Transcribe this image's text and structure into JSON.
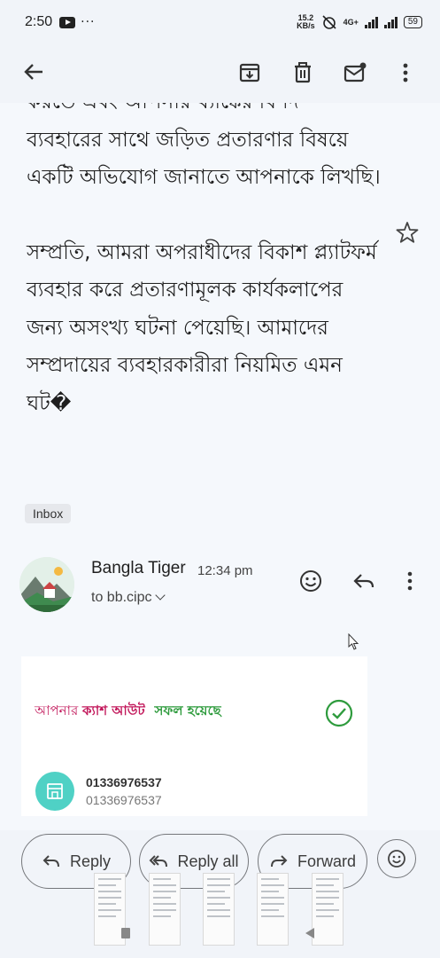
{
  "status_bar": {
    "time": "2:50",
    "more": "···",
    "net_speed_value": "15.2",
    "net_speed_unit": "KB/s",
    "network": "4G+",
    "battery": "59"
  },
  "app_bar": {
    "icons": [
      "back-arrow-icon",
      "archive-icon",
      "delete-icon",
      "mark-unread-icon",
      "more-vert-icon"
    ]
  },
  "message": {
    "paragraph_1": "করতে এবং আপনার ব্যাঙ্কের বিশদ ব্যবহারের সাথে জড়িত প্রতারণার বিষয়ে একটি অভিযোগ জানাতে আপনাকে লিখছি।",
    "paragraph_2": "সম্প্রতি, আমরা অপরাধীদের বিকাশ প্ল্যাটফর্ম ব্যবহার করে প্রতারণামূলক কার্যকলাপের জন্য অসংখ্য ঘটনা পেয়েছি। আমাদের সম্প্রদায়ের ব্যবহারকারীরা নিয়মিত এমন ঘট�",
    "label_chip": "Inbox"
  },
  "sender": {
    "name": "Bangla Tiger",
    "time": "12:34 pm",
    "to": "to bb.cipc"
  },
  "attachment_card": {
    "text_prefix": "আপনার",
    "text_bold": "ক্যাশ আউট",
    "text_success": "সফল হয়েছে",
    "number_bold": "01336976537",
    "number_light": "01336976537"
  },
  "actions": {
    "reply": "Reply",
    "reply_all": "Reply all",
    "forward": "Forward"
  },
  "colors": {
    "background": "#f1f4f9",
    "bkash_pink": "#c2185b",
    "success_green": "#2e9b3d",
    "shop_teal": "#4fd1c5"
  }
}
